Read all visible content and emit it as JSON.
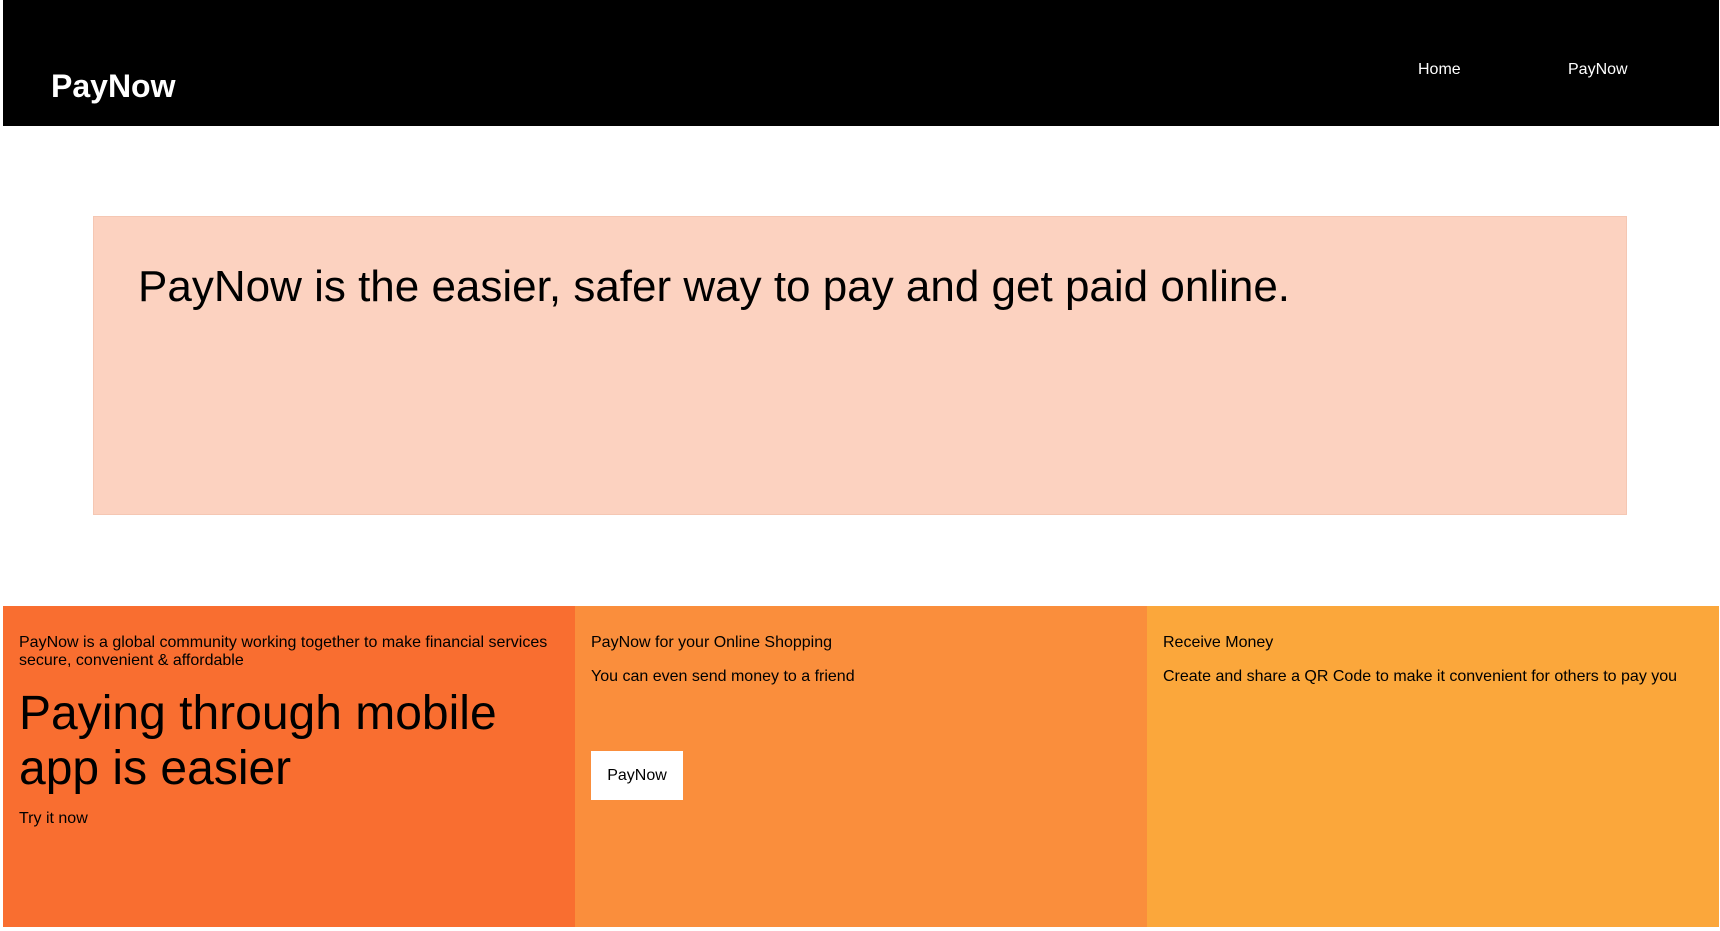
{
  "header": {
    "brand": "PayNow",
    "nav": {
      "home": "Home",
      "paynow": "PayNow"
    }
  },
  "hero": {
    "text": "PayNow is the easier, safer way to pay and get paid online."
  },
  "features": {
    "col1": {
      "intro": "PayNow is a global community working together to make financial services secure, convenient & affordable",
      "headline": "Paying through mobile app is easier",
      "cta_text": "Try it now"
    },
    "col2": {
      "title": "PayNow for your Online Shopping",
      "subtitle": "You can even send money to a friend",
      "button_label": "PayNow"
    },
    "col3": {
      "title": "Receive Money",
      "subtitle": "Create and share a QR Code to make it convenient for others to pay you"
    }
  },
  "colors": {
    "nav_bg": "#000000",
    "hero_bg": "#fcd2c0",
    "col1_bg": "#f96e30",
    "col2_bg": "#fa8e3c",
    "col3_bg": "#fba73b"
  }
}
